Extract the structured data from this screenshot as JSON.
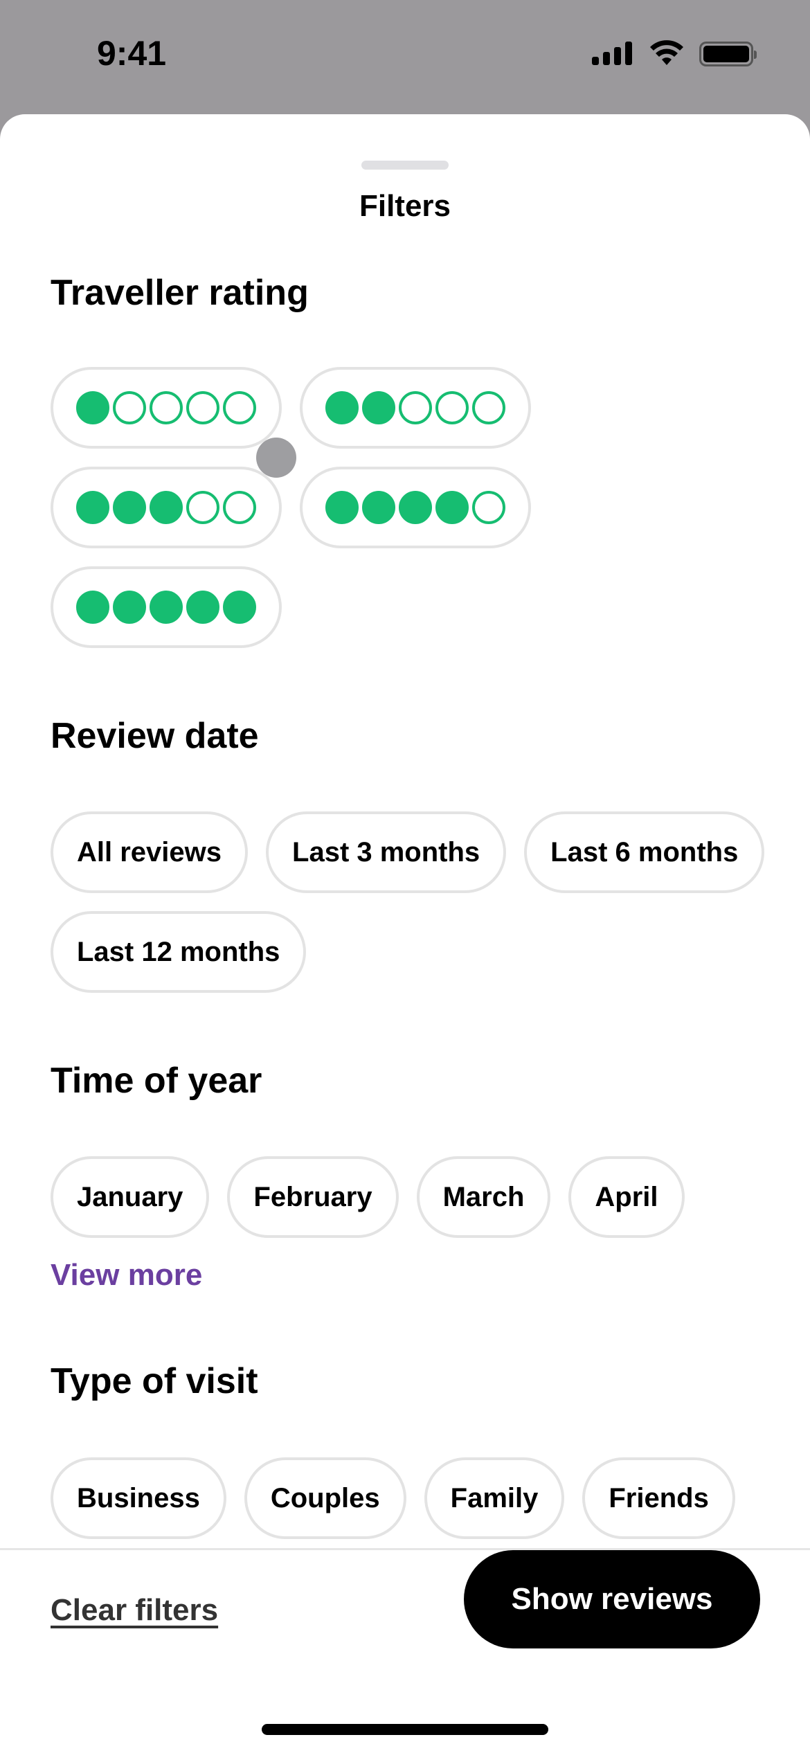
{
  "status_bar": {
    "time": "9:41"
  },
  "sheet": {
    "title": "Filters"
  },
  "traveller_rating": {
    "title": "Traveller rating",
    "options": [
      {
        "rating": 1,
        "max": 5
      },
      {
        "rating": 2,
        "max": 5
      },
      {
        "rating": 3,
        "max": 5
      },
      {
        "rating": 4,
        "max": 5
      },
      {
        "rating": 5,
        "max": 5
      }
    ],
    "accent_color": "#16bd71"
  },
  "review_date": {
    "title": "Review date",
    "options": [
      "All reviews",
      "Last 3 months",
      "Last 6 months",
      "Last 12 months"
    ]
  },
  "time_of_year": {
    "title": "Time of year",
    "options": [
      "January",
      "February",
      "March",
      "April"
    ],
    "view_more": "View more"
  },
  "type_of_visit": {
    "title": "Type of visit",
    "options": [
      "Business",
      "Couples",
      "Family",
      "Friends"
    ]
  },
  "footer": {
    "clear_label": "Clear filters",
    "show_label": "Show reviews"
  }
}
